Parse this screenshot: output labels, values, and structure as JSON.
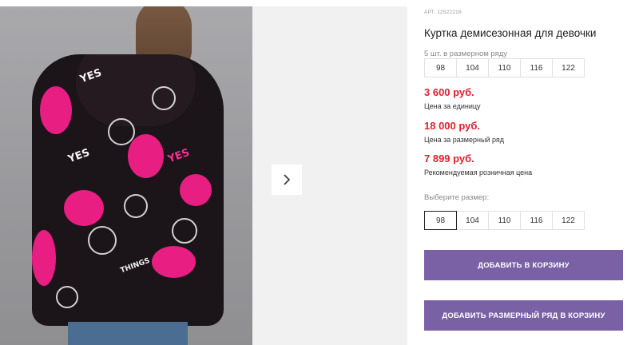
{
  "gallery": {
    "next_icon": "chevron-right-icon"
  },
  "product": {
    "article": "АРТ. 12522216",
    "title": "Куртка демисезонная для девочки"
  },
  "size_row": {
    "label": "5 шт. в размерном ряду",
    "sizes": [
      "98",
      "104",
      "110",
      "116",
      "122"
    ]
  },
  "prices": {
    "unit_price": "3 600 руб.",
    "unit_caption": "Цена за единицу",
    "row_price": "18 000 руб.",
    "row_caption": "Цена за размерный ряд",
    "retail_price": "7 899 руб.",
    "retail_caption": "Рекомендуемая розничная цена"
  },
  "size_select": {
    "label": "Выберите размер:",
    "sizes": [
      "98",
      "104",
      "110",
      "116",
      "122"
    ],
    "selected": "98"
  },
  "actions": {
    "add_to_cart": "ДОБАВИТЬ В КОРЗИНУ",
    "add_row_to_cart": "ДОБАВИТЬ РАЗМЕРНЫЙ РЯД В КОРЗИНУ"
  },
  "colors": {
    "price": "#e0202e",
    "button": "#7a61a6"
  }
}
